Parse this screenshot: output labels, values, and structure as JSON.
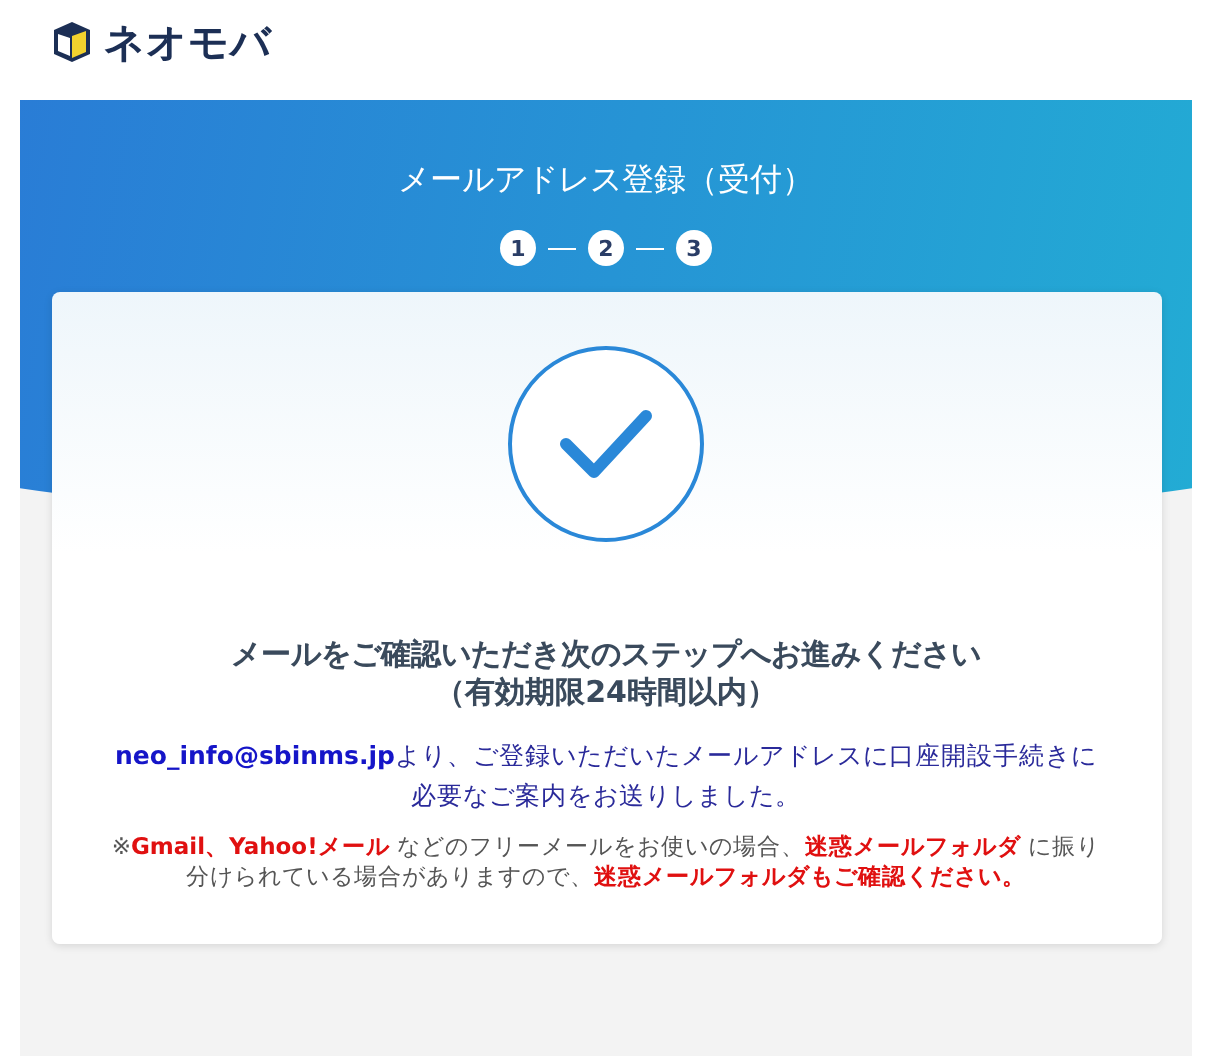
{
  "header": {
    "brand": "ネオモバ"
  },
  "hero": {
    "title": "メールアドレス登録（受付）",
    "steps": [
      "1",
      "2",
      "3"
    ]
  },
  "card": {
    "heading": "メールをご確認いただき次のステップへお進みください",
    "subheading": "（有効期限24時間以内）",
    "message": "**neo_info@sbinms.jp**より、ご登録いただいたメールアドレスに口座開設手続きに必要なご案内をお送りしました。",
    "note": "※**Gmail、Yahoo!メール** などのフリーメールをお使いの場合、**迷惑メールフォルダ** に振り分けられている場合がありますので、**迷惑メールフォルダもご確認ください。**"
  }
}
